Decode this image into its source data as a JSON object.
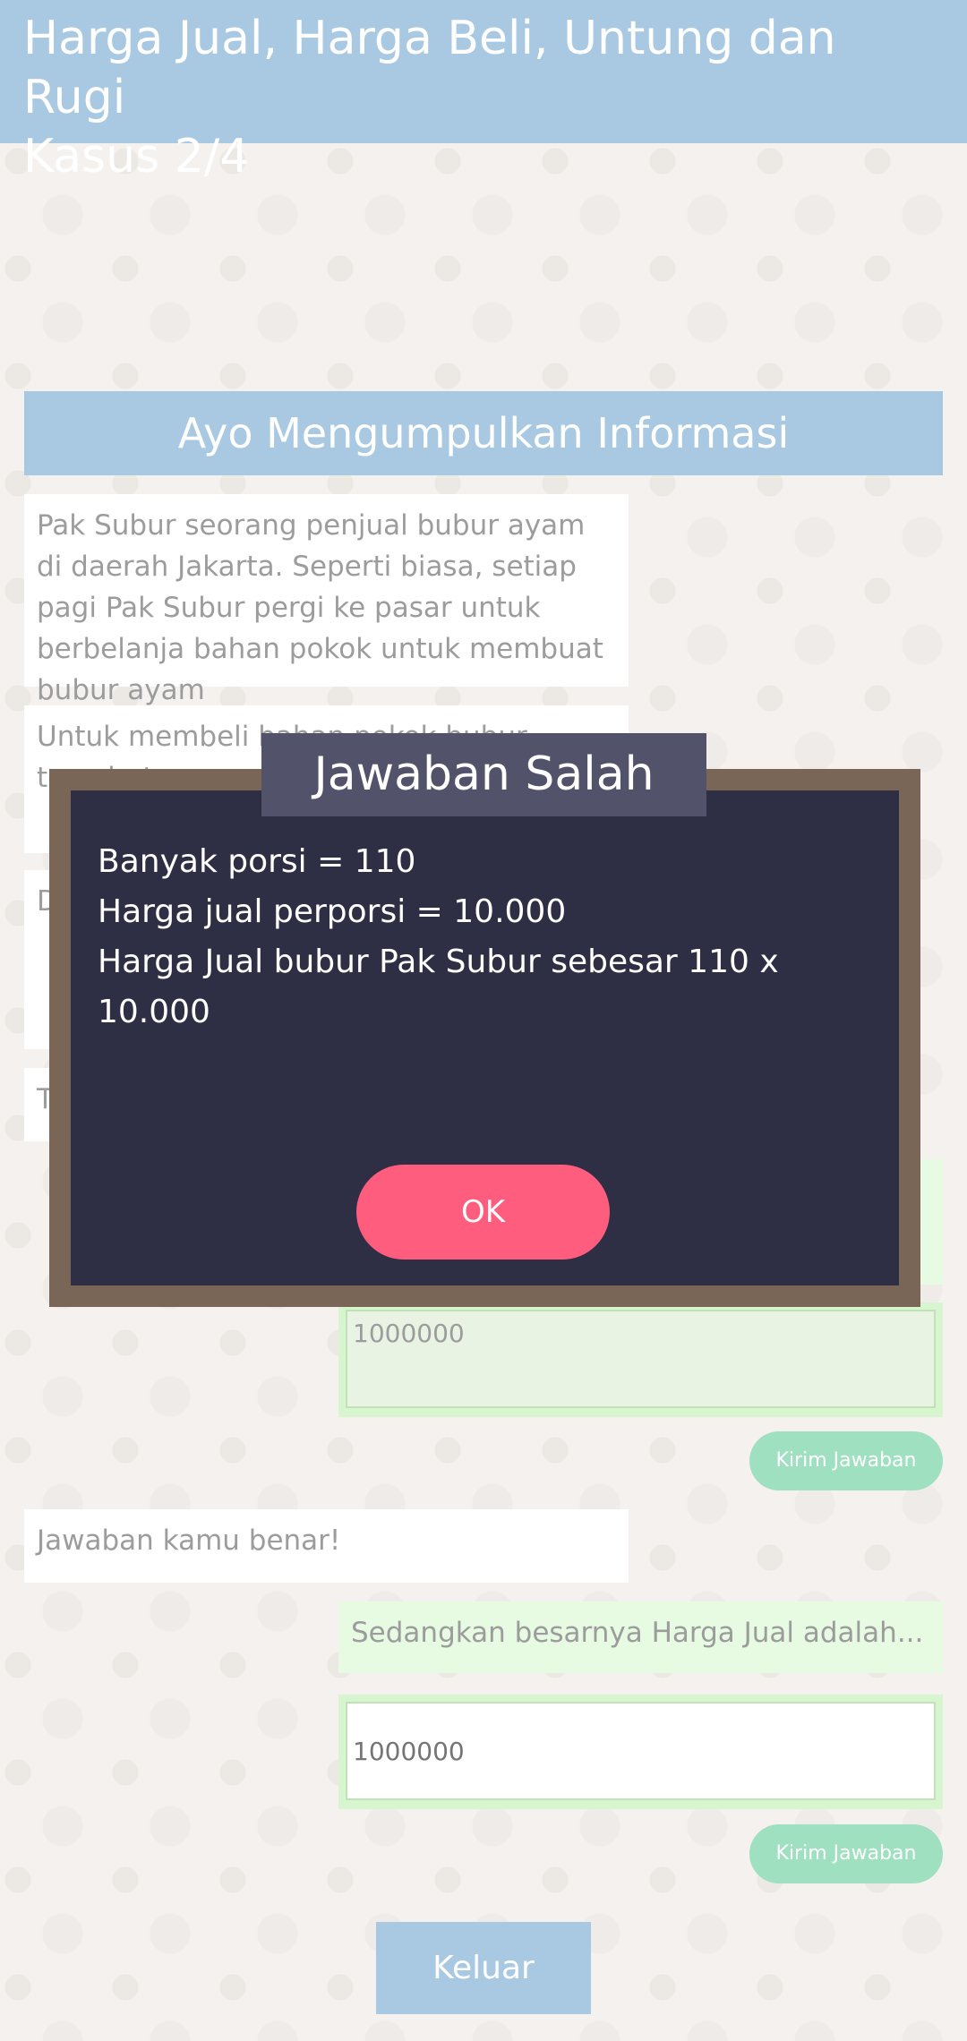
{
  "header": {
    "title": "Harga Jual, Harga Beli, Untung dan Rugi",
    "case": "Kasus 2/4"
  },
  "section_title": "Ayo Mengumpulkan Informasi",
  "story": {
    "p1": "Pak Subur seorang penjual bubur ayam di daerah Jakarta. Seperti biasa, setiap pagi Pak Subur pergi ke pasar untuk berbelanja bahan pokok untuk membuat bubur ayam",
    "p2": "Untuk membeli bahan pokok bubur tersebut",
    "p3_start": "D",
    "p4_start": "T"
  },
  "chat": {
    "answer1_value": "1000000",
    "send_label_1": "Kirim Jawaban",
    "feedback": "Jawaban kamu benar!",
    "question2": "Sedangkan besarnya Harga Jual adalah...",
    "answer2_placeholder": "1000000",
    "send_label_2": "Kirim Jawaban"
  },
  "exit_label": "Keluar",
  "modal": {
    "title": "Jawaban Salah",
    "line1": "Banyak porsi = 110",
    "line2": "Harga jual perporsi = 10.000",
    "line3": "Harga Jual bubur Pak Subur sebesar 110 x 10.000",
    "ok_label": "OK"
  }
}
